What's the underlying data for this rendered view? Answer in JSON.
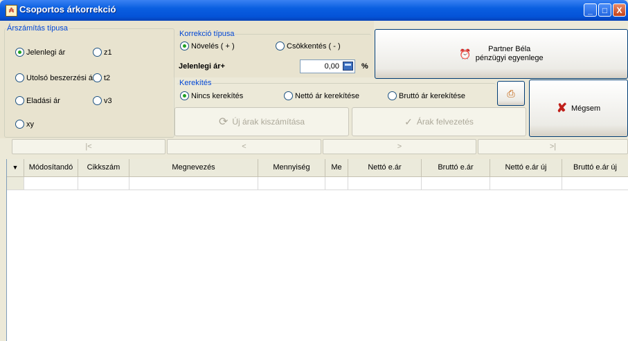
{
  "window": {
    "title": "Csoportos árkorrekció",
    "minimize": "_",
    "maximize": "□",
    "close": "X"
  },
  "arszamitas": {
    "legend": "Árszámítás típusa",
    "options": [
      "Jelenlegi ár",
      "z1",
      "Utolsó beszerzési ár",
      "t2",
      "Eladási ár",
      "v3",
      "xy"
    ],
    "selected": "Jelenlegi ár"
  },
  "korrekcio": {
    "legend": "Korrekció típusa",
    "options": [
      "Növelés ( + )",
      "Csökkentés ( - )"
    ],
    "selected": "Növelés ( + )",
    "value_label": "Jelenlegi ár+",
    "value": "0,00",
    "unit": "%"
  },
  "kerekites": {
    "legend": "Kerekítés",
    "options": [
      "Nincs kerekítés",
      "Nettó ár kerekítése",
      "Bruttó ár kerekítése"
    ],
    "selected": "Nincs kerekítés"
  },
  "buttons": {
    "partner_line1": "Partner Béla",
    "partner_line2": "pénzügyi egyenlege",
    "cancel": "Mégsem",
    "calc": "Új árak kiszámítása",
    "commit": "Árak felvezetés"
  },
  "nav": [
    "|<",
    "<",
    ">",
    ">|"
  ],
  "grid": {
    "columns": [
      "Módosítandó",
      "Cikkszám",
      "Megnevezés",
      "Mennyiség",
      "Me",
      "Nettó e.ár",
      "Bruttó e.ár",
      "Nettó e.ár új",
      "Bruttó e.ár új"
    ]
  },
  "colors": {
    "title_bar": "#0453d8",
    "legend": "#0046d5",
    "radio_dot": "#21a121",
    "cancel_x": "#c0201a"
  }
}
